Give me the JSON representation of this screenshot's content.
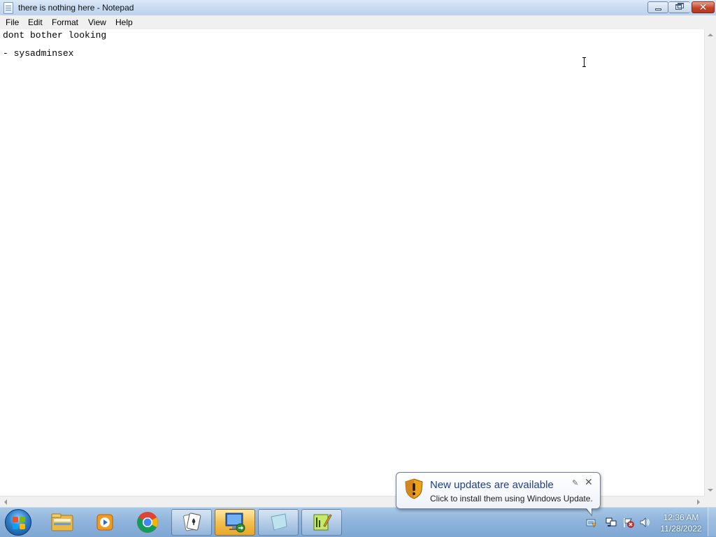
{
  "window": {
    "title": "there is nothing here - Notepad",
    "close_glyph": "✕"
  },
  "menu": {
    "items": [
      "File",
      "Edit",
      "Format",
      "View",
      "Help"
    ]
  },
  "editor": {
    "lines": [
      "dont bother looking",
      "",
      "- sysadminsex"
    ]
  },
  "taskbar": {
    "pinned_icons": [
      "explorer-icon",
      "media-player-icon",
      "chrome-icon",
      "solitaire-icon",
      "remote-desktop-icon",
      "sticky-note-icon",
      "notepadpp-icon"
    ],
    "clock": {
      "time": "12:36 AM",
      "date": "11/28/2022"
    }
  },
  "tray": {
    "icons": [
      "windows-update-icon",
      "network-icon",
      "action-center-flag-icon",
      "volume-icon"
    ]
  },
  "notification": {
    "title": "New updates are available",
    "body": "Click to install them using Windows Update.",
    "options_glyph": "✎",
    "close_glyph": "✕"
  },
  "colors": {
    "balloon_title": "#1e3f8a",
    "taskbar": "#8fb4dc",
    "close_button": "#c4452b"
  }
}
